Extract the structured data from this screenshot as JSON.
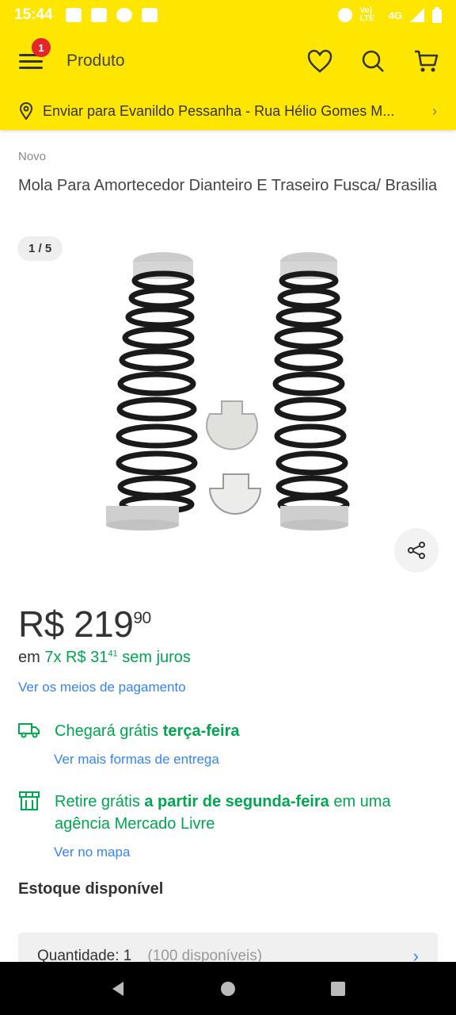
{
  "status_bar": {
    "time": "15:44",
    "network_label": "Vo) LTE",
    "network_type": "4G"
  },
  "app_bar": {
    "title": "Produto",
    "notification_count": "1"
  },
  "address": {
    "text": "Enviar para Evanildo Pessanha - Rua Hélio Gomes M..."
  },
  "product": {
    "condition": "Novo",
    "title": "Mola Para Amortecedor Dianteiro E Traseiro Fusca/ Brasilia",
    "gallery_counter": "1 / 5"
  },
  "price": {
    "currency": "R$",
    "integer": "219",
    "cents": "90",
    "installments_prefix": "em",
    "installments_count": "7x R$ 31",
    "installments_cents": "41",
    "installments_suffix": "sem juros",
    "payment_link": "Ver os meios de pagamento"
  },
  "shipping": {
    "delivery_prefix": "Chegará grátis ",
    "delivery_day": "terça-feira",
    "delivery_link": "Ver mais formas de entrega",
    "pickup_prefix": "Retire grátis ",
    "pickup_day": "a partir de segunda-feira",
    "pickup_suffix": " em uma agência Mercado Livre",
    "pickup_link": "Ver no mapa"
  },
  "stock": {
    "title": "Estoque disponível",
    "quantity_label": "Quantidade: 1",
    "available": "(100 disponíveis)"
  },
  "colors": {
    "brand_yellow": "#ffe600",
    "link_blue": "#3483fa",
    "green": "#00a650",
    "badge_red": "#e3262c"
  }
}
